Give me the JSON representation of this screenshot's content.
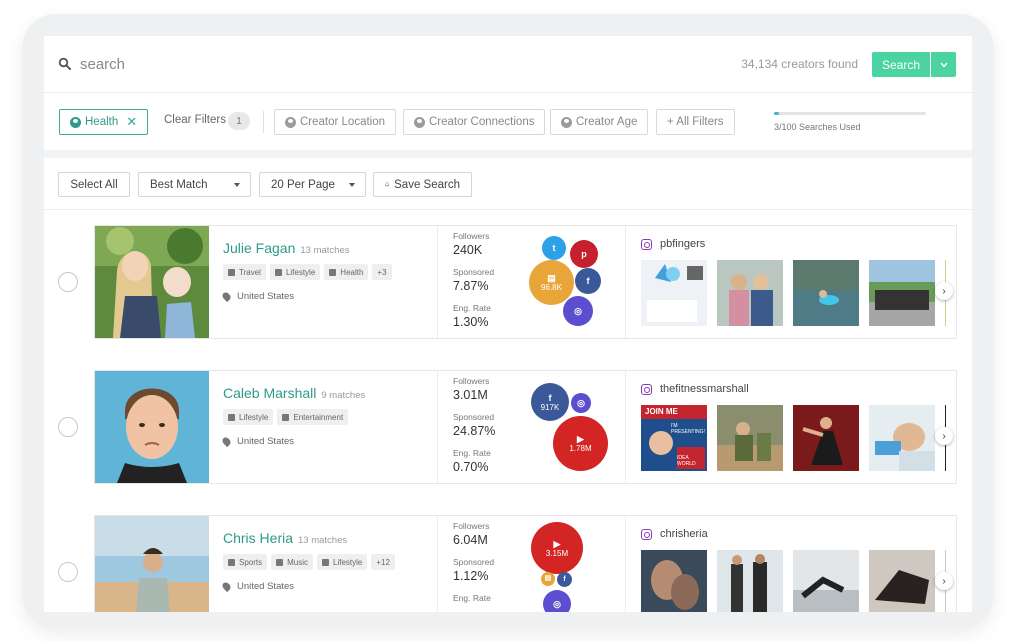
{
  "search": {
    "placeholder": "search",
    "found_text": "34,134 creators found",
    "button_label": "Search"
  },
  "filters": {
    "active_chip": "Health",
    "clear_label": "Clear Filters",
    "clear_count": "1",
    "location": "Creator Location",
    "connections": "Creator Connections",
    "age": "Creator Age",
    "all_filters": "+ All Filters",
    "usage_text": "3/100 Searches Used",
    "usage_fraction": 0.03
  },
  "toolbar": {
    "select_all": "Select All",
    "sort": "Best Match",
    "per_page": "20 Per Page",
    "save_search": "Save Search"
  },
  "stat_labels": {
    "followers": "Followers",
    "sponsored": "Sponsored",
    "eng_rate": "Eng. Rate"
  },
  "creators": [
    {
      "name": "Julie Fagan",
      "matches": "13 matches",
      "tags": [
        "Travel",
        "Lifestyle",
        "Health",
        "+3"
      ],
      "location": "United States",
      "followers": "240K",
      "sponsored": "7.87%",
      "eng_rate": "1.30%",
      "bubble_label": "96.8K",
      "instagram_handle": "pbfingers"
    },
    {
      "name": "Caleb Marshall",
      "matches": "9 matches",
      "tags": [
        "Lifestyle",
        "Entertainment"
      ],
      "location": "United States",
      "followers": "3.01M",
      "sponsored": "24.87%",
      "eng_rate": "0.70%",
      "bubble_label_fb": "917K",
      "bubble_label_yt": "1.78M",
      "instagram_handle": "thefitnessmarshall",
      "thumb_text": [
        "JOIN ME",
        "I'M PRESENTING!",
        "IDEA WORLD"
      ]
    },
    {
      "name": "Chris Heria",
      "matches": "13 matches",
      "tags": [
        "Sports",
        "Music",
        "Lifestyle",
        "+12"
      ],
      "location": "United States",
      "followers": "6.04M",
      "sponsored": "1.12%",
      "eng_rate": "",
      "bubble_label": "3.15M",
      "instagram_handle": "chrisheria"
    }
  ],
  "colors": {
    "accent": "#4cd3a2",
    "name_teal": "#2e9a8c",
    "twitter": "#2da1e6",
    "pinterest": "#c4202d",
    "facebook": "#3b5998",
    "instagram_bubble": "#5b4fd0",
    "youtube": "#d42525",
    "blog": "#e8a53a"
  },
  "icons": {
    "search": "search-icon",
    "user": "user-icon",
    "bell": "bell-icon",
    "pin": "location-pin-icon",
    "instagram": "instagram-icon",
    "chevron_right": "chevron-right-icon"
  }
}
